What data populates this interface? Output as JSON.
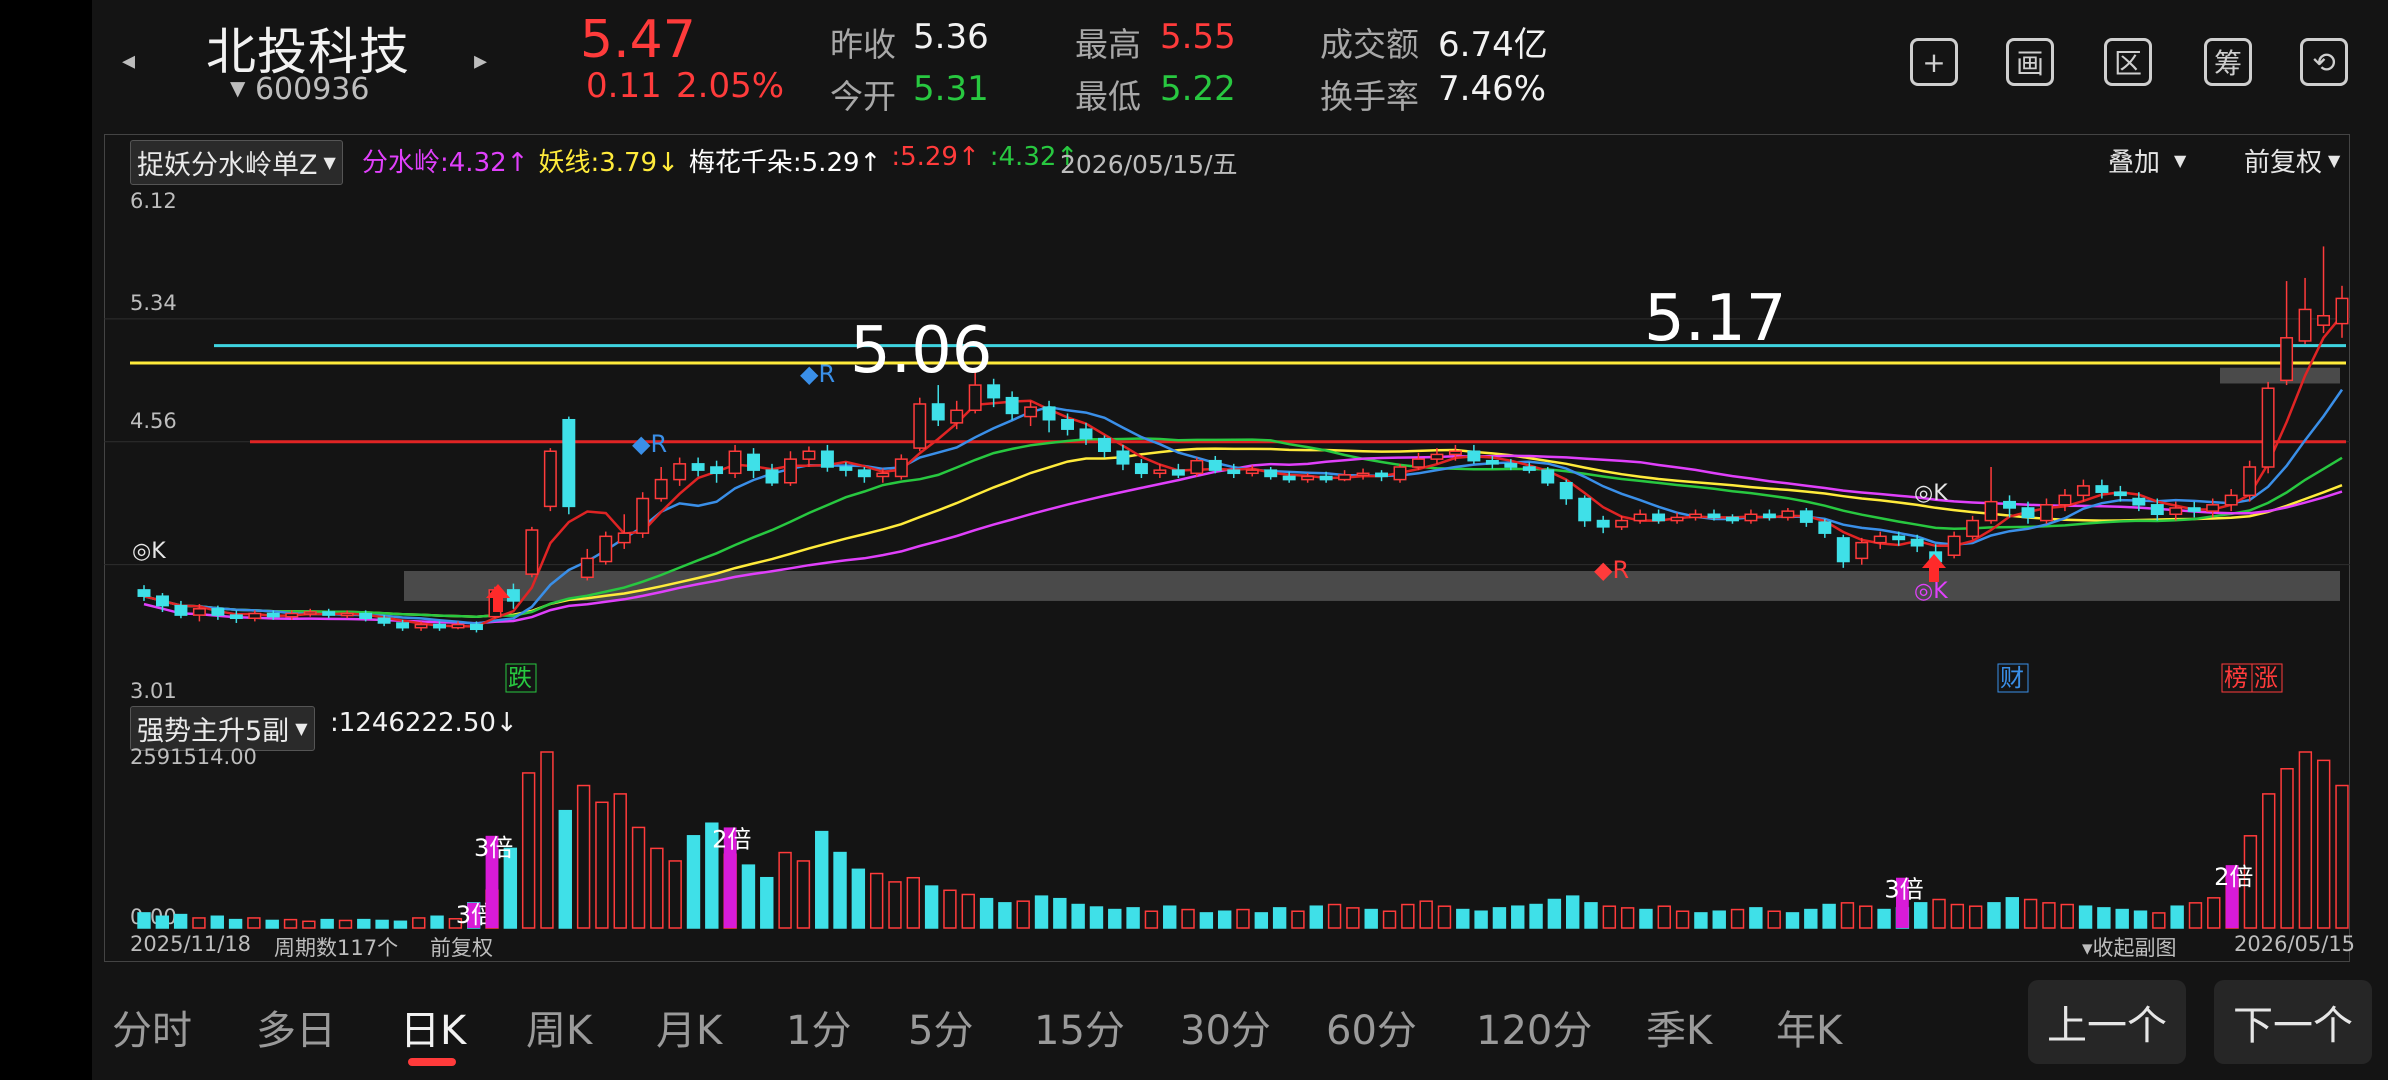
{
  "header": {
    "prev_icon": "chevron-left-icon",
    "next_icon": "chevron-right-icon",
    "name": "北投科技",
    "code": "600936",
    "price": "5.47",
    "change": "0.11",
    "change_pct": "2.05%",
    "stats": {
      "prev_close_label": "昨收",
      "prev_close": "5.36",
      "open_label": "今开",
      "open": "5.31",
      "high_label": "最高",
      "high": "5.55",
      "low_label": "最低",
      "low": "5.22",
      "amount_label": "成交额",
      "amount": "6.74亿",
      "turnover_label": "换手率",
      "turnover": "7.46%"
    },
    "tools": [
      {
        "name": "add-icon",
        "glyph": "+"
      },
      {
        "name": "draw-icon",
        "glyph": "画"
      },
      {
        "name": "range-icon",
        "glyph": "区"
      },
      {
        "name": "chip-icon",
        "glyph": "筹"
      },
      {
        "name": "landscape-rotate-icon",
        "glyph": "⟲"
      }
    ]
  },
  "main_chart": {
    "indicator": "捉妖分水岭单Z",
    "legend": [
      {
        "text": "分水岭:4.32↑",
        "color": "#e040fb"
      },
      {
        "text": "妖线:3.79↓",
        "color": "#ffeb3b"
      },
      {
        "text": "梅花千朵:5.29↑",
        "color": "#ffffff"
      },
      {
        "text": ":5.29↑",
        "color": "#ff3b3b"
      },
      {
        "text": ":4.32↑",
        "color": "#28c840"
      }
    ],
    "date": "2026/05/15/五",
    "overlay": "叠加",
    "adjust": "前复权",
    "y_labels": [
      "6.12",
      "5.34",
      "4.56",
      "3.01"
    ],
    "annotations": {
      "price_a": "5.06",
      "price_b": "5.17"
    },
    "markers": [
      "R",
      "R",
      "R",
      "K",
      "K",
      "K"
    ],
    "signals": {
      "die": "跌",
      "cai": "财",
      "bang": "榜",
      "zhang": "涨"
    }
  },
  "sub_chart": {
    "indicator": "强势主升5副",
    "value": ":1246222.50↓",
    "y_max": "2591514.00",
    "y_min": "0.00",
    "bei_labels": [
      "3倍",
      "3倍",
      "2倍",
      "3倍",
      "2倍"
    ],
    "start_date": "2025/11/18",
    "period_count": "周期数117个",
    "adjust": "前复权",
    "collapse": "收起副图",
    "end_date": "2026/05/15"
  },
  "chart_data": {
    "type": "candlestick",
    "y_range": [
      3.01,
      6.12
    ],
    "bars": [
      [
        3.62,
        3.58,
        3.65,
        3.55
      ],
      [
        3.58,
        3.52,
        3.6,
        3.48
      ],
      [
        3.52,
        3.46,
        3.55,
        3.44
      ],
      [
        3.46,
        3.5,
        3.53,
        3.42
      ],
      [
        3.5,
        3.46,
        3.52,
        3.43
      ],
      [
        3.46,
        3.44,
        3.49,
        3.41
      ],
      [
        3.44,
        3.47,
        3.49,
        3.42
      ],
      [
        3.47,
        3.45,
        3.49,
        3.43
      ],
      [
        3.45,
        3.47,
        3.49,
        3.43
      ],
      [
        3.47,
        3.48,
        3.5,
        3.45
      ],
      [
        3.48,
        3.46,
        3.5,
        3.44
      ],
      [
        3.46,
        3.47,
        3.49,
        3.44
      ],
      [
        3.47,
        3.44,
        3.49,
        3.42
      ],
      [
        3.44,
        3.41,
        3.46,
        3.39
      ],
      [
        3.41,
        3.38,
        3.43,
        3.36
      ],
      [
        3.38,
        3.4,
        3.42,
        3.36
      ],
      [
        3.4,
        3.38,
        3.42,
        3.36
      ],
      [
        3.38,
        3.4,
        3.42,
        3.37
      ],
      [
        3.4,
        3.37,
        3.42,
        3.35
      ],
      [
        3.45,
        3.62,
        3.64,
        3.44
      ],
      [
        3.62,
        3.55,
        3.66,
        3.5
      ],
      [
        3.72,
        4.0,
        4.02,
        3.7
      ],
      [
        4.15,
        4.5,
        4.52,
        4.12
      ],
      [
        4.7,
        4.15,
        4.72,
        4.1
      ],
      [
        3.7,
        3.82,
        3.88,
        3.68
      ],
      [
        3.8,
        3.96,
        3.99,
        3.78
      ],
      [
        3.92,
        3.98,
        4.1,
        3.88
      ],
      [
        3.98,
        4.2,
        4.24,
        3.95
      ],
      [
        4.2,
        4.32,
        4.4,
        4.18
      ],
      [
        4.32,
        4.42,
        4.46,
        4.28
      ],
      [
        4.42,
        4.38,
        4.46,
        4.34
      ],
      [
        4.4,
        4.36,
        4.44,
        4.3
      ],
      [
        4.36,
        4.5,
        4.54,
        4.33
      ],
      [
        4.48,
        4.38,
        4.52,
        4.33
      ],
      [
        4.38,
        4.3,
        4.42,
        4.28
      ],
      [
        4.3,
        4.45,
        4.5,
        4.28
      ],
      [
        4.45,
        4.5,
        4.53,
        4.4
      ],
      [
        4.5,
        4.4,
        4.54,
        4.37
      ],
      [
        4.4,
        4.38,
        4.43,
        4.34
      ],
      [
        4.38,
        4.34,
        4.4,
        4.3
      ],
      [
        4.34,
        4.36,
        4.39,
        4.3
      ],
      [
        4.34,
        4.45,
        4.48,
        4.32
      ],
      [
        4.52,
        4.8,
        4.84,
        4.5
      ],
      [
        4.8,
        4.7,
        4.92,
        4.66
      ],
      [
        4.68,
        4.76,
        4.82,
        4.64
      ],
      [
        4.76,
        4.92,
        5.0,
        4.74
      ],
      [
        4.92,
        4.84,
        4.96,
        4.78
      ],
      [
        4.84,
        4.74,
        4.88,
        4.7
      ],
      [
        4.72,
        4.78,
        4.82,
        4.66
      ],
      [
        4.78,
        4.7,
        4.82,
        4.62
      ],
      [
        4.7,
        4.64,
        4.74,
        4.6
      ],
      [
        4.64,
        4.58,
        4.68,
        4.54
      ],
      [
        4.58,
        4.5,
        4.6,
        4.46
      ],
      [
        4.5,
        4.42,
        4.54,
        4.38
      ],
      [
        4.42,
        4.36,
        4.45,
        4.33
      ],
      [
        4.36,
        4.38,
        4.42,
        4.33
      ],
      [
        4.38,
        4.35,
        4.42,
        4.33
      ],
      [
        4.36,
        4.44,
        4.46,
        4.34
      ],
      [
        4.44,
        4.38,
        4.47,
        4.36
      ],
      [
        4.38,
        4.36,
        4.42,
        4.33
      ],
      [
        4.36,
        4.38,
        4.41,
        4.34
      ],
      [
        4.38,
        4.34,
        4.4,
        4.32
      ],
      [
        4.34,
        4.32,
        4.37,
        4.3
      ],
      [
        4.32,
        4.34,
        4.36,
        4.3
      ],
      [
        4.34,
        4.32,
        4.37,
        4.3
      ],
      [
        4.32,
        4.35,
        4.38,
        4.31
      ],
      [
        4.35,
        4.36,
        4.39,
        4.32
      ],
      [
        4.36,
        4.34,
        4.38,
        4.31
      ],
      [
        4.32,
        4.4,
        4.42,
        4.3
      ],
      [
        4.4,
        4.45,
        4.49,
        4.38
      ],
      [
        4.45,
        4.48,
        4.52,
        4.42
      ],
      [
        4.48,
        4.5,
        4.54,
        4.44
      ],
      [
        4.5,
        4.44,
        4.54,
        4.42
      ],
      [
        4.44,
        4.42,
        4.47,
        4.39
      ],
      [
        4.42,
        4.4,
        4.45,
        4.38
      ],
      [
        4.4,
        4.38,
        4.43,
        4.36
      ],
      [
        4.38,
        4.3,
        4.4,
        4.28
      ],
      [
        4.3,
        4.2,
        4.32,
        4.16
      ],
      [
        4.2,
        4.06,
        4.22,
        4.02
      ],
      [
        4.06,
        4.02,
        4.09,
        3.98
      ],
      [
        4.02,
        4.06,
        4.09,
        4.0
      ],
      [
        4.06,
        4.1,
        4.13,
        4.04
      ],
      [
        4.1,
        4.06,
        4.13,
        4.04
      ],
      [
        4.06,
        4.08,
        4.11,
        4.04
      ],
      [
        4.08,
        4.1,
        4.13,
        4.06
      ],
      [
        4.1,
        4.08,
        4.13,
        4.06
      ],
      [
        4.08,
        4.06,
        4.1,
        4.04
      ],
      [
        4.06,
        4.1,
        4.13,
        4.04
      ],
      [
        4.1,
        4.08,
        4.13,
        4.06
      ],
      [
        4.08,
        4.12,
        4.14,
        4.06
      ],
      [
        4.12,
        4.05,
        4.14,
        4.02
      ],
      [
        4.05,
        3.98,
        4.07,
        3.95
      ],
      [
        3.95,
        3.8,
        3.97,
        3.76
      ],
      [
        3.82,
        3.92,
        3.95,
        3.78
      ],
      [
        3.92,
        3.96,
        3.99,
        3.88
      ],
      [
        3.96,
        3.94,
        3.99,
        3.9
      ],
      [
        3.94,
        3.9,
        3.97,
        3.86
      ],
      [
        3.86,
        3.8,
        3.91,
        3.78
      ],
      [
        3.84,
        3.96,
        3.99,
        3.82
      ],
      [
        3.96,
        4.06,
        4.09,
        3.94
      ],
      [
        4.06,
        4.18,
        4.4,
        4.04
      ],
      [
        4.18,
        4.14,
        4.22,
        4.08
      ],
      [
        4.14,
        4.08,
        4.18,
        4.04
      ],
      [
        4.06,
        4.16,
        4.2,
        4.04
      ],
      [
        4.16,
        4.22,
        4.26,
        4.12
      ],
      [
        4.22,
        4.28,
        4.32,
        4.18
      ],
      [
        4.28,
        4.24,
        4.32,
        4.2
      ],
      [
        4.24,
        4.22,
        4.28,
        4.18
      ],
      [
        4.2,
        4.16,
        4.24,
        4.12
      ],
      [
        4.16,
        4.1,
        4.2,
        4.06
      ],
      [
        4.1,
        4.14,
        4.18,
        4.06
      ],
      [
        4.14,
        4.12,
        4.18,
        4.08
      ],
      [
        4.12,
        4.16,
        4.2,
        4.08
      ],
      [
        4.16,
        4.22,
        4.26,
        4.12
      ],
      [
        4.22,
        4.4,
        4.44,
        4.18
      ],
      [
        4.4,
        4.9,
        4.94,
        4.36
      ],
      [
        4.95,
        5.22,
        5.58,
        4.92
      ],
      [
        5.2,
        5.4,
        5.6,
        5.18
      ],
      [
        5.3,
        5.36,
        5.8,
        5.25
      ],
      [
        5.31,
        5.47,
        5.55,
        5.22
      ]
    ],
    "volume": [
      18,
      14,
      16,
      12,
      14,
      10,
      12,
      9,
      10,
      8,
      10,
      9,
      10,
      9,
      8,
      12,
      14,
      11,
      30,
      45,
      95,
      185,
      210,
      140,
      170,
      150,
      160,
      120,
      95,
      80,
      110,
      125,
      88,
      75,
      60,
      90,
      80,
      115,
      90,
      70,
      65,
      55,
      60,
      50,
      45,
      40,
      35,
      30,
      32,
      38,
      35,
      28,
      25,
      22,
      24,
      20,
      26,
      22,
      18,
      20,
      22,
      18,
      24,
      20,
      26,
      28,
      24,
      22,
      20,
      28,
      32,
      26,
      22,
      20,
      24,
      26,
      28,
      34,
      38,
      30,
      26,
      24,
      22,
      26,
      20,
      18,
      20,
      22,
      24,
      20,
      18,
      22,
      28,
      30,
      26,
      22,
      24,
      30,
      34,
      28,
      26,
      30,
      36,
      34,
      30,
      28,
      26,
      24,
      22,
      20,
      18,
      26,
      30,
      36,
      60,
      110,
      160,
      190,
      210,
      200,
      170
    ],
    "h_lines": {
      "cyan": 5.17,
      "yellow": 5.06,
      "red": 4.56
    },
    "zones": [
      {
        "top": 3.74,
        "bottom": 3.55
      },
      {
        "top": 5.03,
        "bottom": 4.93
      }
    ]
  },
  "tabs": [
    "分时",
    "多日",
    "日K",
    "周K",
    "月K",
    "1分",
    "5分",
    "15分",
    "30分",
    "60分",
    "120分",
    "季K",
    "年K"
  ],
  "active_tab": "日K",
  "nav": {
    "prev": "上一个",
    "next": "下一个"
  }
}
